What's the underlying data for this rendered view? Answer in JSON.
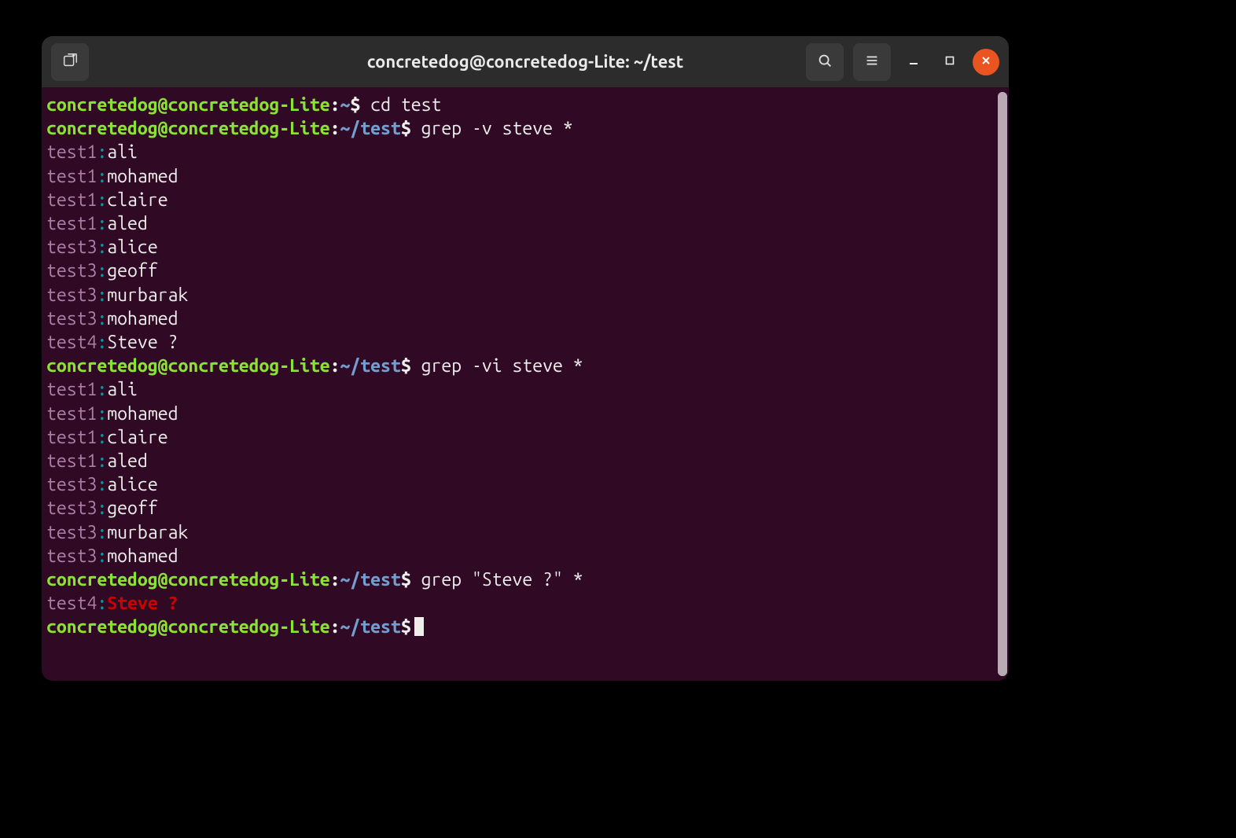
{
  "titlebar": {
    "title": "concretedog@concretedog-Lite: ~/test",
    "new_tab_name": "new-tab",
    "search_name": "search",
    "menu_name": "hamburger-menu",
    "minimize_name": "minimize",
    "maximize_name": "maximize",
    "close_name": "close"
  },
  "prompt": {
    "userhost": "concretedog@concretedog-Lite",
    "home_path": "~",
    "test_path": "~/test",
    "colon": ":",
    "dollar": "$"
  },
  "commands": {
    "c1": " cd test",
    "c2": " grep -v steve *",
    "c3": " grep -vi steve *",
    "c4": " grep \"Steve ?\" *"
  },
  "output": {
    "sep": ":",
    "r1": {
      "file": "test1",
      "text": "ali"
    },
    "r2": {
      "file": "test1",
      "text": "mohamed"
    },
    "r3": {
      "file": "test1",
      "text": "claire"
    },
    "r4": {
      "file": "test1",
      "text": "aled"
    },
    "r5": {
      "file": "test3",
      "text": "alice"
    },
    "r6": {
      "file": "test3",
      "text": "geoff"
    },
    "r7": {
      "file": "test3",
      "text": "murbarak"
    },
    "r8": {
      "file": "test3",
      "text": "mohamed"
    },
    "r9": {
      "file": "test4",
      "text": "Steve ?"
    },
    "r10": {
      "file": "test1",
      "text": "ali"
    },
    "r11": {
      "file": "test1",
      "text": "mohamed"
    },
    "r12": {
      "file": "test1",
      "text": "claire"
    },
    "r13": {
      "file": "test1",
      "text": "aled"
    },
    "r14": {
      "file": "test3",
      "text": "alice"
    },
    "r15": {
      "file": "test3",
      "text": "geoff"
    },
    "r16": {
      "file": "test3",
      "text": "murbarak"
    },
    "r17": {
      "file": "test3",
      "text": "mohamed"
    },
    "r18": {
      "file": "test4",
      "match": "Steve ?"
    }
  }
}
